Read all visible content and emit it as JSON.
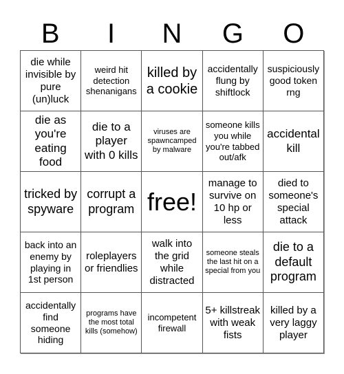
{
  "header": {
    "letters": [
      "B",
      "I",
      "N",
      "G",
      "O"
    ]
  },
  "cells": [
    "die while invisible by pure (un)luck",
    "weird hit detection shenanigans",
    "killed by a cookie",
    "accidentally flung by shiftlock",
    "suspiciously good token rng",
    "die as you're eating food",
    "die to a player with 0 kills",
    "viruses are spawncamped by malware",
    "someone kills you while you're tabbed out/afk",
    "accidental kill",
    "tricked by spyware",
    "corrupt a program",
    "free!",
    "manage to survive on 10 hp or less",
    "died to someone's special attack",
    "back into an enemy by playing in 1st person",
    "roleplayers or friendlies",
    "walk into the grid while distracted",
    "someone steals the last hit on a special from you",
    "die to a default program",
    "accidentally find someone hiding",
    "programs have the most total kills (somehow)",
    "incompetent firewall",
    "5+ killstreak with weak fists",
    "killed by a very laggy player"
  ]
}
